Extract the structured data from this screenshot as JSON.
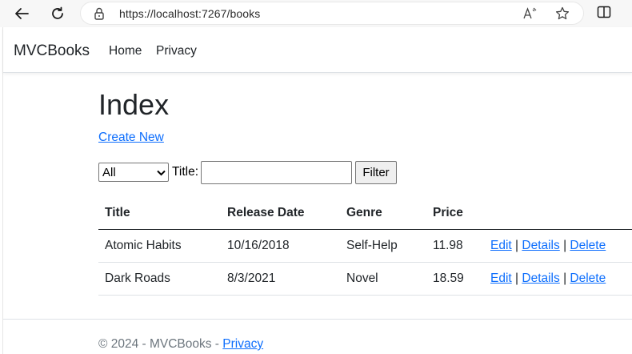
{
  "browser": {
    "url_scheme": "https://",
    "url_host": "localhost",
    "url_rest": ":7267/books"
  },
  "navbar": {
    "brand": "MVCBooks",
    "links": [
      {
        "label": "Home"
      },
      {
        "label": "Privacy"
      }
    ]
  },
  "main": {
    "title": "Index",
    "create_link": "Create New",
    "filter": {
      "genre_selected": "All",
      "title_label": "Title:",
      "title_value": "",
      "button_label": "Filter"
    },
    "table": {
      "headers": [
        "Title",
        "Release Date",
        "Genre",
        "Price",
        ""
      ],
      "rows": [
        {
          "title": "Atomic Habits",
          "release_date": "10/16/2018",
          "genre": "Self-Help",
          "price": "11.98"
        },
        {
          "title": "Dark Roads",
          "release_date": "8/3/2021",
          "genre": "Novel",
          "price": "18.59"
        }
      ],
      "actions": {
        "edit": "Edit",
        "details": "Details",
        "delete": "Delete",
        "separator": "|"
      }
    }
  },
  "footer": {
    "text": "© 2024 - MVCBooks - ",
    "privacy_link": "Privacy"
  },
  "icons": [
    "back-arrow-icon",
    "refresh-icon",
    "lock-icon",
    "read-aloud-icon",
    "favorite-star-icon",
    "split-screen-icon",
    "chevron-down-icon"
  ],
  "colors": {
    "link": "#0d6efd",
    "text": "#212529",
    "muted": "#6c757d"
  }
}
